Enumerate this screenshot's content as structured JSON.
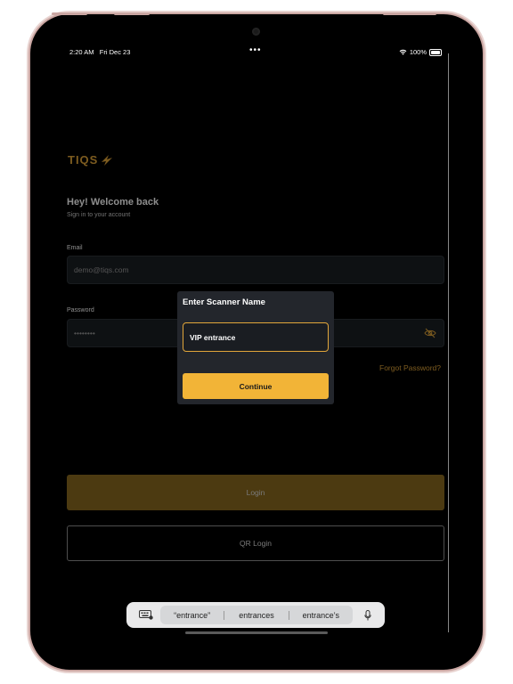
{
  "status": {
    "time": "2:20 AM",
    "date": "Fri Dec 23",
    "dots": "•••",
    "battery": "100%"
  },
  "brand": {
    "logo_text": "TIQS",
    "accent": "#e2a63a"
  },
  "login": {
    "heading": "Hey! Welcome back",
    "subheading": "Sign in to your account",
    "email_label": "Email",
    "email_placeholder": "demo@tiqs.com",
    "password_label": "Password",
    "password_value": "••••••••",
    "forgot": "Forgot Password?",
    "login_button": "Login",
    "qr_button": "QR Login"
  },
  "modal": {
    "title": "Enter Scanner Name",
    "input_value": "VIP entrance",
    "continue_button": "Continue"
  },
  "keyboard": {
    "suggestions": [
      "“entrance”",
      "entrances",
      "entrance’s"
    ]
  }
}
